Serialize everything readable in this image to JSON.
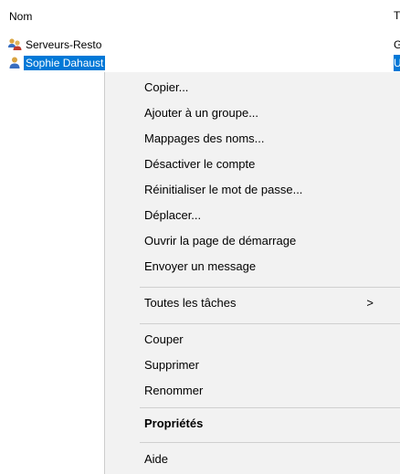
{
  "list": {
    "columns": {
      "name": "Nom",
      "type": "Type"
    },
    "rows": [
      {
        "label": "Serveurs-Resto",
        "type": "Groupe",
        "icon": "group-icon",
        "selected": false
      },
      {
        "label": "Sophie Dahaust",
        "type": "Utilisateur",
        "icon": "user-icon",
        "selected": true
      }
    ]
  },
  "context_menu": {
    "items": [
      {
        "label": "Copier..."
      },
      {
        "label": "Ajouter à un groupe..."
      },
      {
        "label": "Mappages des noms..."
      },
      {
        "label": "Désactiver le compte"
      },
      {
        "label": "Réinitialiser le mot de passe..."
      },
      {
        "label": "Déplacer..."
      },
      {
        "label": "Ouvrir la page de démarrage"
      },
      {
        "label": "Envoyer un message"
      },
      {
        "label": "Toutes les tâches",
        "submenu": true,
        "arrow": ">"
      },
      {
        "label": "Couper"
      },
      {
        "label": "Supprimer"
      },
      {
        "label": "Renommer"
      },
      {
        "label": "Propriétés",
        "bold": true
      },
      {
        "label": "Aide"
      }
    ]
  },
  "colors": {
    "selection": "#0078d7",
    "menu_background": "#f2f2f2",
    "separator": "#cfcfcf"
  }
}
